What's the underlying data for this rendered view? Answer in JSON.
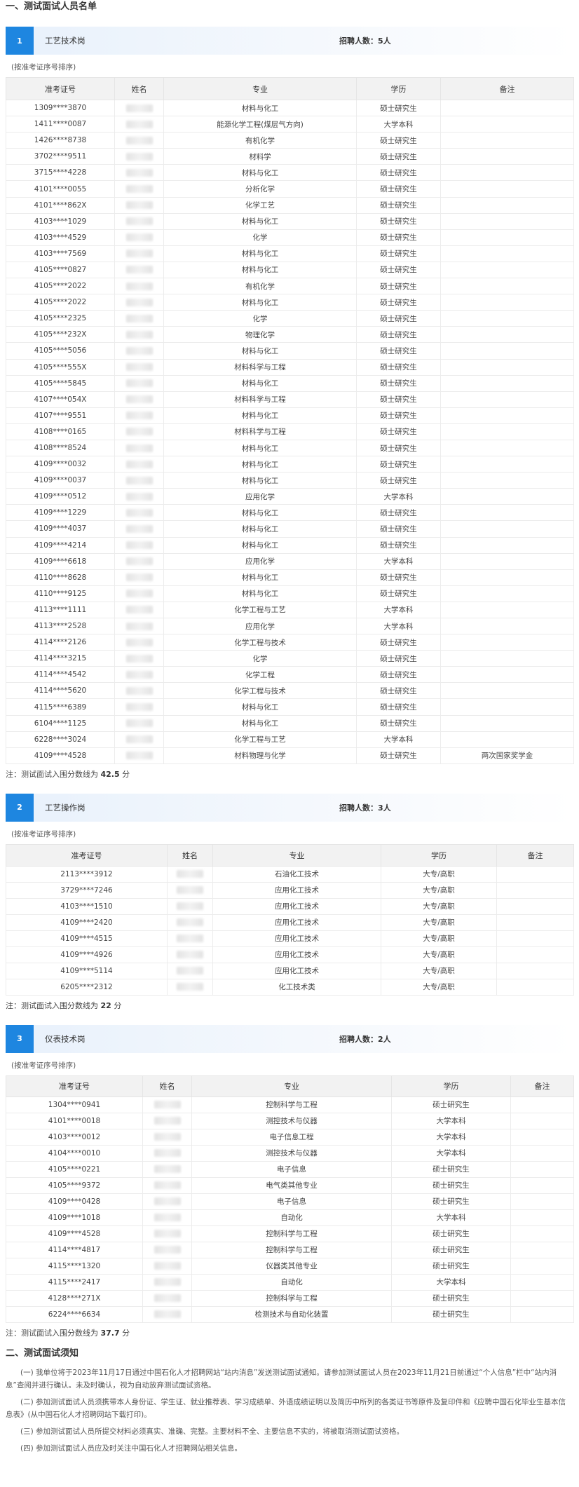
{
  "section1_title": "一、测试面试人员名单",
  "section2_title": "二、测试面试须知",
  "headers": {
    "ticket": "准考证号",
    "name": "姓名",
    "major": "专业",
    "education": "学历",
    "remark": "备注"
  },
  "posts": [
    {
      "num": "1",
      "name": "工艺技术岗",
      "quota": "招聘人数：5人",
      "order_note": "(按准考证序号排序)",
      "rows": [
        [
          "1309****3870",
          "材料与化工",
          "硕士研究生",
          ""
        ],
        [
          "1411****0087",
          "能源化学工程(煤层气方向)",
          "大学本科",
          ""
        ],
        [
          "1426****8738",
          "有机化学",
          "硕士研究生",
          ""
        ],
        [
          "3702****9511",
          "材料学",
          "硕士研究生",
          ""
        ],
        [
          "3715****4228",
          "材料与化工",
          "硕士研究生",
          ""
        ],
        [
          "4101****0055",
          "分析化学",
          "硕士研究生",
          ""
        ],
        [
          "4101****862X",
          "化学工艺",
          "硕士研究生",
          ""
        ],
        [
          "4103****1029",
          "材料与化工",
          "硕士研究生",
          ""
        ],
        [
          "4103****4529",
          "化学",
          "硕士研究生",
          ""
        ],
        [
          "4103****7569",
          "材料与化工",
          "硕士研究生",
          ""
        ],
        [
          "4105****0827",
          "材料与化工",
          "硕士研究生",
          ""
        ],
        [
          "4105****2022",
          "有机化学",
          "硕士研究生",
          ""
        ],
        [
          "4105****2022",
          "材料与化工",
          "硕士研究生",
          ""
        ],
        [
          "4105****2325",
          "化学",
          "硕士研究生",
          ""
        ],
        [
          "4105****232X",
          "物理化学",
          "硕士研究生",
          ""
        ],
        [
          "4105****5056",
          "材料与化工",
          "硕士研究生",
          ""
        ],
        [
          "4105****555X",
          "材料科学与工程",
          "硕士研究生",
          ""
        ],
        [
          "4105****5845",
          "材料与化工",
          "硕士研究生",
          ""
        ],
        [
          "4107****054X",
          "材料科学与工程",
          "硕士研究生",
          ""
        ],
        [
          "4107****9551",
          "材料与化工",
          "硕士研究生",
          ""
        ],
        [
          "4108****0165",
          "材料科学与工程",
          "硕士研究生",
          ""
        ],
        [
          "4108****8524",
          "材料与化工",
          "硕士研究生",
          ""
        ],
        [
          "4109****0032",
          "材料与化工",
          "硕士研究生",
          ""
        ],
        [
          "4109****0037",
          "材料与化工",
          "硕士研究生",
          ""
        ],
        [
          "4109****0512",
          "应用化学",
          "大学本科",
          ""
        ],
        [
          "4109****1229",
          "材料与化工",
          "硕士研究生",
          ""
        ],
        [
          "4109****4037",
          "材料与化工",
          "硕士研究生",
          ""
        ],
        [
          "4109****4214",
          "材料与化工",
          "硕士研究生",
          ""
        ],
        [
          "4109****6618",
          "应用化学",
          "大学本科",
          ""
        ],
        [
          "4110****8628",
          "材料与化工",
          "硕士研究生",
          ""
        ],
        [
          "4110****9125",
          "材料与化工",
          "硕士研究生",
          ""
        ],
        [
          "4113****1111",
          "化学工程与工艺",
          "大学本科",
          ""
        ],
        [
          "4113****2528",
          "应用化学",
          "大学本科",
          ""
        ],
        [
          "4114****2126",
          "化学工程与技术",
          "硕士研究生",
          ""
        ],
        [
          "4114****3215",
          "化学",
          "硕士研究生",
          ""
        ],
        [
          "4114****4542",
          "化学工程",
          "硕士研究生",
          ""
        ],
        [
          "4114****5620",
          "化学工程与技术",
          "硕士研究生",
          ""
        ],
        [
          "4115****6389",
          "材料与化工",
          "硕士研究生",
          ""
        ],
        [
          "6104****1125",
          "材料与化工",
          "硕士研究生",
          ""
        ],
        [
          "6228****3024",
          "化学工程与工艺",
          "大学本科",
          ""
        ],
        [
          "4109****4528",
          "材料物理与化学",
          "硕士研究生",
          "两次国家奖学金"
        ]
      ],
      "footnote_prefix": "注：测试面试入围分数线为",
      "footnote_score": "42.5",
      "footnote_suffix": "分"
    },
    {
      "num": "2",
      "name": "工艺操作岗",
      "quota": "招聘人数：3人",
      "order_note": "(按准考证序号排序)",
      "rows": [
        [
          "2113****3912",
          "石油化工技术",
          "大专/高职",
          ""
        ],
        [
          "3729****7246",
          "应用化工技术",
          "大专/高职",
          ""
        ],
        [
          "4103****1510",
          "应用化工技术",
          "大专/高职",
          ""
        ],
        [
          "4109****2420",
          "应用化工技术",
          "大专/高职",
          ""
        ],
        [
          "4109****4515",
          "应用化工技术",
          "大专/高职",
          ""
        ],
        [
          "4109****4926",
          "应用化工技术",
          "大专/高职",
          ""
        ],
        [
          "4109****5114",
          "应用化工技术",
          "大专/高职",
          ""
        ],
        [
          "6205****2312",
          "化工技术类",
          "大专/高职",
          ""
        ]
      ],
      "footnote_prefix": "注：测试面试入围分数线为",
      "footnote_score": "22",
      "footnote_suffix": "分"
    },
    {
      "num": "3",
      "name": "仪表技术岗",
      "quota": "招聘人数：2人",
      "order_note": "(按准考证序号排序)",
      "rows": [
        [
          "1304****0941",
          "控制科学与工程",
          "硕士研究生",
          ""
        ],
        [
          "4101****0018",
          "测控技术与仪器",
          "大学本科",
          ""
        ],
        [
          "4103****0012",
          "电子信息工程",
          "大学本科",
          ""
        ],
        [
          "4104****0010",
          "测控技术与仪器",
          "大学本科",
          ""
        ],
        [
          "4105****0221",
          "电子信息",
          "硕士研究生",
          ""
        ],
        [
          "4105****9372",
          "电气类其他专业",
          "硕士研究生",
          ""
        ],
        [
          "4109****0428",
          "电子信息",
          "硕士研究生",
          ""
        ],
        [
          "4109****1018",
          "自动化",
          "大学本科",
          ""
        ],
        [
          "4109****4528",
          "控制科学与工程",
          "硕士研究生",
          ""
        ],
        [
          "4114****4817",
          "控制科学与工程",
          "硕士研究生",
          ""
        ],
        [
          "4115****1320",
          "仪器类其他专业",
          "硕士研究生",
          ""
        ],
        [
          "4115****2417",
          "自动化",
          "大学本科",
          ""
        ],
        [
          "4128****271X",
          "控制科学与工程",
          "硕士研究生",
          ""
        ],
        [
          "6224****6634",
          "检测技术与自动化装置",
          "硕士研究生",
          ""
        ]
      ],
      "footnote_prefix": "注：测试面试入围分数线为",
      "footnote_score": "37.7",
      "footnote_suffix": "分"
    }
  ],
  "notices": [
    "(一) 我单位将于2023年11月17日通过中国石化人才招聘网站“站内消息”发送测试面试通知。请参加测试面试人员在2023年11月21日前通过“个人信息”栏中“站内消息”查阅并进行确认。未及时确认，视为自动放弃测试面试资格。",
    "(二) 参加测试面试人员须携带本人身份证、学生证、就业推荐表、学习成绩单、外语成绩证明以及简历中所列的各类证书等原件及复印件和《应聘中国石化毕业生基本信息表》(从中国石化人才招聘网站下载打印)。",
    "(三) 参加测试面试人员所提交材料必须真实、准确、完整。主要材料不全、主要信息不实的，将被取消测试面试资格。",
    "(四) 参加测试面试人员应及时关注中国石化人才招聘网站相关信息。"
  ]
}
